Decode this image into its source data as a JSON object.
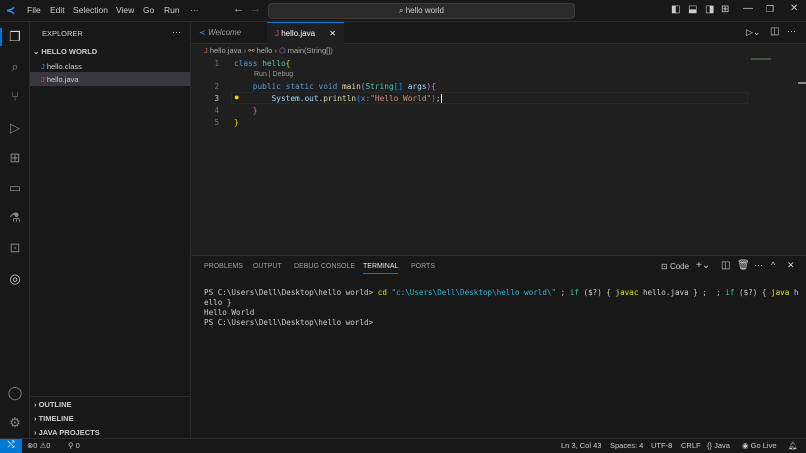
{
  "titlebar": {
    "menus": [
      "File",
      "Edit",
      "Selection",
      "View",
      "Go",
      "Run",
      "···"
    ],
    "search": "hello world"
  },
  "sidebar": {
    "title": "EXPLORER",
    "more": "···",
    "folder": "HELLO WORLD",
    "files": [
      {
        "name": "hello.class",
        "selected": false
      },
      {
        "name": "hello.java",
        "selected": true
      }
    ],
    "sections": [
      "OUTLINE",
      "TIMELINE",
      "JAVA PROJECTS"
    ]
  },
  "tabs": [
    {
      "label": "Welcome"
    },
    {
      "label": "hello.java",
      "active": true
    }
  ],
  "breadcrumb": [
    "hello.java",
    "hello",
    "main(String[])"
  ],
  "editor": {
    "line_numbers": [
      "1",
      "2",
      "3",
      "4",
      "5"
    ],
    "codelens": "Run | Debug",
    "param_hint": "x:"
  },
  "panel": {
    "tabs": [
      "PROBLEMS",
      "OUTPUT",
      "DEBUG CONSOLE",
      "TERMINAL",
      "PORTS"
    ],
    "active": "TERMINAL",
    "shell": "Code",
    "terminal": {
      "prompt": "PS C:\\Users\\Dell\\Desktop\\hello world>",
      "cmd": "cd",
      "path": "\"c:\\Users\\Dell\\Desktop\\hello world\\\"",
      "rest1": " ; ",
      "if": "if",
      "cond": " ($?) { ",
      "javac": "javac",
      "javac_arg": " hello.java } ; ",
      "java": "java",
      "java_arg": " h",
      "wrap": "ello }",
      "output": "Hello World"
    }
  },
  "status": {
    "errors": "0",
    "warnings": "0",
    "ports": "0",
    "position": "Ln 3, Col 43",
    "spaces": "Spaces: 4",
    "encoding": "UTF-8",
    "eol": "CRLF",
    "language": "{} Java",
    "golive": "Go Live"
  }
}
